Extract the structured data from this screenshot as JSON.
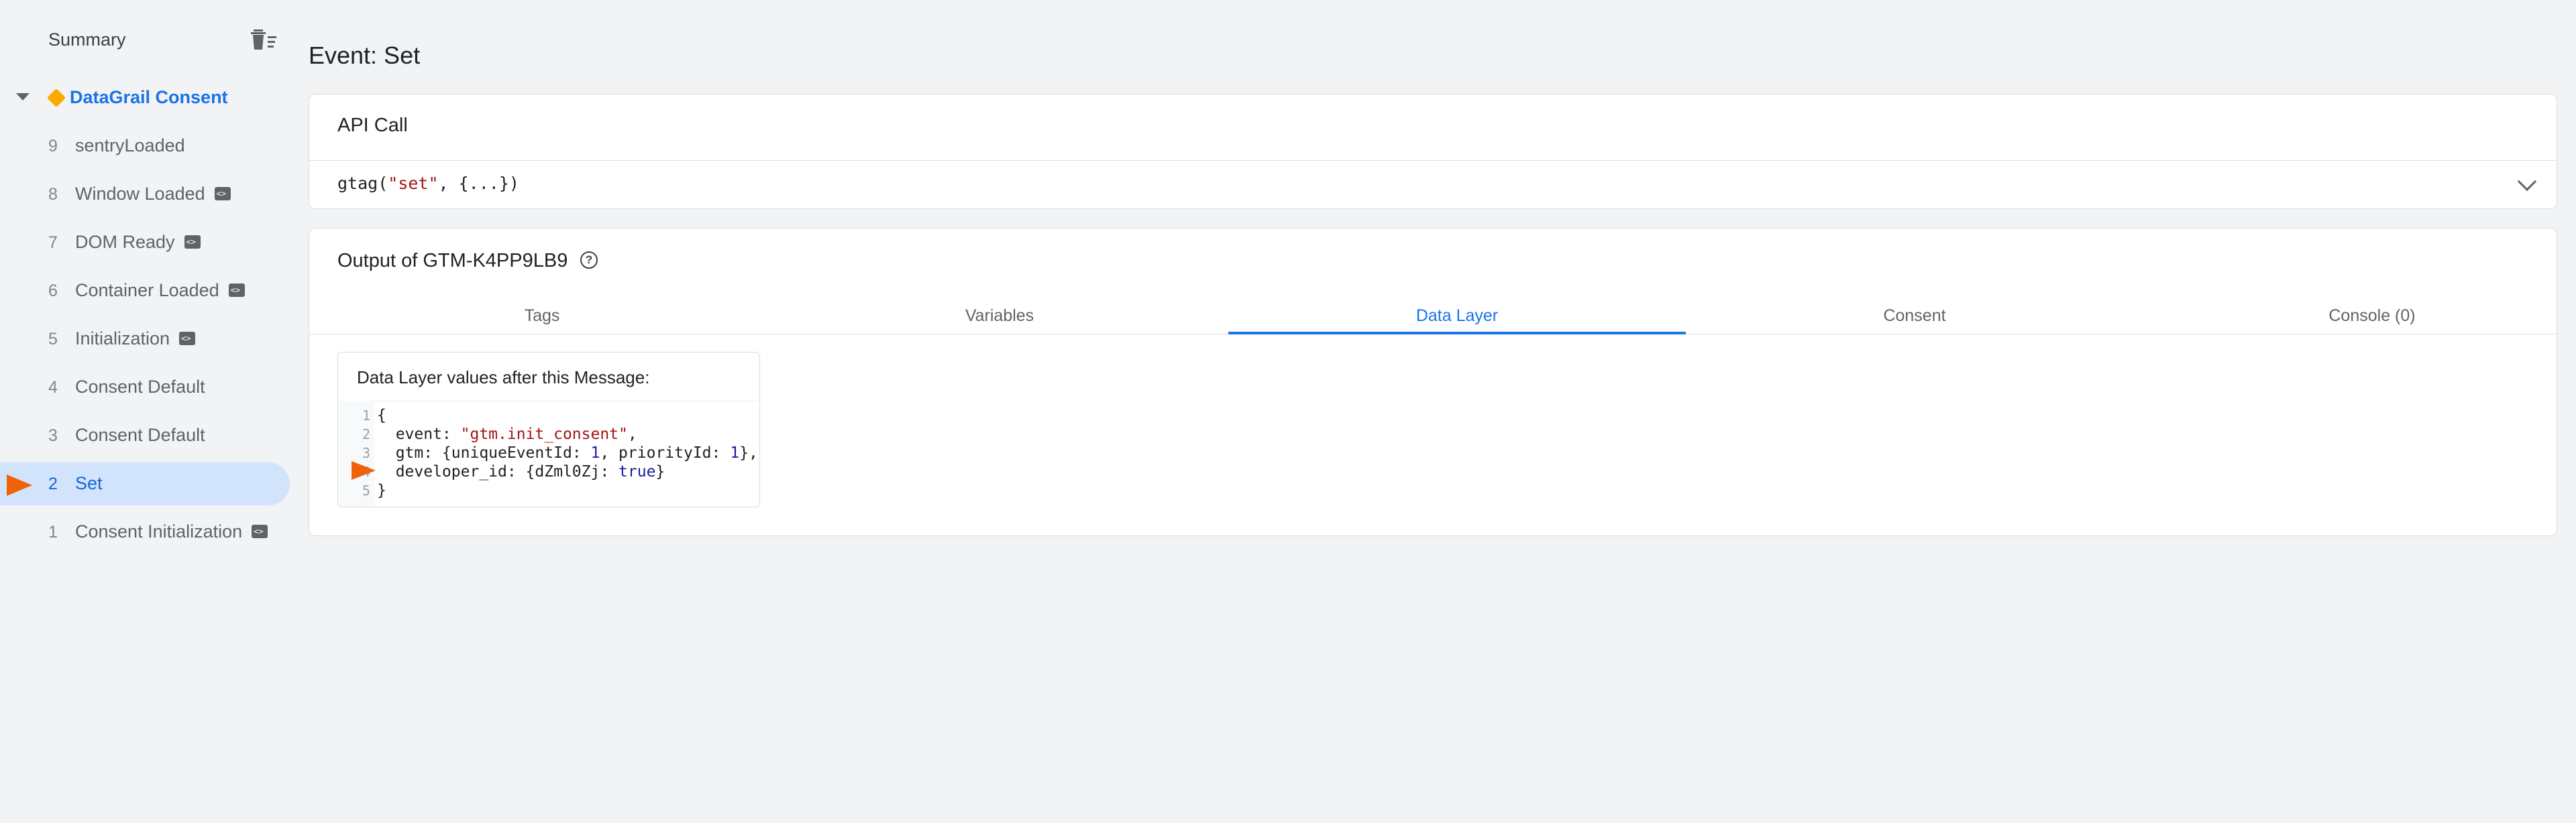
{
  "sidebar": {
    "summary_label": "Summary",
    "group_label": "DataGrail Consent",
    "items": [
      {
        "num": "9",
        "label": "sentryLoaded",
        "badge": false,
        "selected": false
      },
      {
        "num": "8",
        "label": "Window Loaded",
        "badge": true,
        "selected": false
      },
      {
        "num": "7",
        "label": "DOM Ready",
        "badge": true,
        "selected": false
      },
      {
        "num": "6",
        "label": "Container Loaded",
        "badge": true,
        "selected": false
      },
      {
        "num": "5",
        "label": "Initialization",
        "badge": true,
        "selected": false
      },
      {
        "num": "4",
        "label": "Consent Default",
        "badge": false,
        "selected": false
      },
      {
        "num": "3",
        "label": "Consent Default",
        "badge": false,
        "selected": false
      },
      {
        "num": "2",
        "label": "Set",
        "badge": false,
        "selected": true
      },
      {
        "num": "1",
        "label": "Consent Initialization",
        "badge": true,
        "selected": false
      }
    ]
  },
  "main": {
    "title": "Event: Set",
    "api_card": {
      "title": "API Call",
      "code_fn": "gtag(",
      "code_str": "\"set\"",
      "code_rest": ", {...})"
    },
    "output_card": {
      "title": "Output of GTM-K4PP9LB9",
      "help_glyph": "?",
      "tabs": [
        "Tags",
        "Variables",
        "Data Layer",
        "Consent",
        "Console (0)"
      ],
      "active_tab": "Data Layer",
      "data_layer": {
        "heading": "Data Layer values after this Message:",
        "lines": [
          {
            "n": "1",
            "parts": [
              {
                "t": "{",
                "c": ""
              }
            ]
          },
          {
            "n": "2",
            "parts": [
              {
                "t": "  event: ",
                "c": ""
              },
              {
                "t": "\"gtm.init_consent\"",
                "c": "str"
              },
              {
                "t": ",",
                "c": ""
              }
            ]
          },
          {
            "n": "3",
            "parts": [
              {
                "t": "  gtm: {uniqueEventId: ",
                "c": ""
              },
              {
                "t": "1",
                "c": "kw"
              },
              {
                "t": ", priorityId: ",
                "c": ""
              },
              {
                "t": "1",
                "c": "kw"
              },
              {
                "t": "}, ",
                "c": ""
              }
            ]
          },
          {
            "n": "4",
            "parts": [
              {
                "t": "  developer_id: {dZml0Zj: ",
                "c": ""
              },
              {
                "t": "true",
                "c": "kw"
              },
              {
                "t": "}",
                "c": ""
              }
            ]
          },
          {
            "n": "5",
            "parts": [
              {
                "t": "}",
                "c": ""
              }
            ]
          }
        ]
      }
    }
  },
  "colors": {
    "accent": "#1a73e8",
    "marker": "#f0620a",
    "selected_bg": "#d2e3fc"
  }
}
